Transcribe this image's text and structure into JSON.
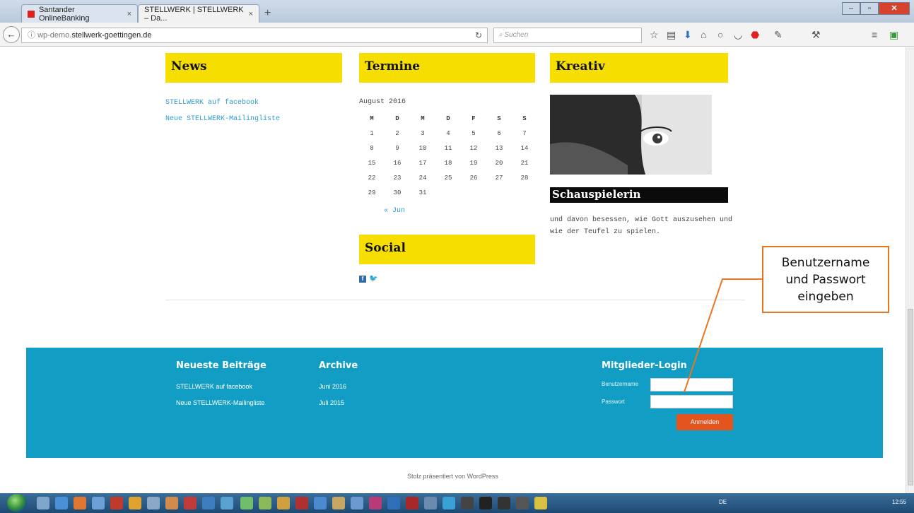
{
  "browser": {
    "tabs": [
      {
        "title": "Santander OnlineBanking",
        "active": false
      },
      {
        "title": "STELLWERK | STELLWERK – Da...",
        "active": true
      }
    ],
    "new_tab_label": "+",
    "close_symbol": "×",
    "url_scheme_part": "wp-demo.",
    "url_host": "stellwerk-goettingen.de",
    "search_placeholder": "Suchen",
    "toolbar_icons": [
      "bookmark-star-icon",
      "reading-list-icon",
      "download-icon",
      "home-icon",
      "hello-icon",
      "pocket-icon",
      "adblock-icon",
      "translate-icon",
      "tools-icon",
      "menu-icon",
      "addon-icon"
    ]
  },
  "widgets": {
    "news": {
      "title": "News",
      "items": [
        "STELLWERK auf facebook",
        "Neue STELLWERK-Mailingliste"
      ]
    },
    "termine": {
      "title": "Termine",
      "caption": "August 2016",
      "weekdays": [
        "M",
        "D",
        "M",
        "D",
        "F",
        "S",
        "S"
      ],
      "weeks": [
        [
          "1",
          "2",
          "3",
          "4",
          "5",
          "6",
          "7"
        ],
        [
          "8",
          "9",
          "10",
          "11",
          "12",
          "13",
          "14"
        ],
        [
          "15",
          "16",
          "17",
          "18",
          "19",
          "20",
          "21"
        ],
        [
          "22",
          "23",
          "24",
          "25",
          "26",
          "27",
          "28"
        ],
        [
          "29",
          "30",
          "31",
          "",
          "",
          "",
          ""
        ]
      ],
      "prev_link": "« Jun"
    },
    "social": {
      "title": "Social",
      "icons": [
        "facebook-icon",
        "twitter-icon"
      ]
    },
    "kreativ": {
      "title": "Kreativ",
      "caption": "Schauspielerin",
      "text": "und davon besessen, wie Gott auszusehen und wie der Teufel zu spielen."
    }
  },
  "footer": {
    "recent_posts": {
      "title": "Neueste Beiträge",
      "items": [
        "STELLWERK auf facebook",
        "Neue STELLWERK-Mailingliste"
      ]
    },
    "archive": {
      "title": "Archive",
      "items": [
        "Juni 2016",
        "Juli 2015"
      ]
    },
    "login": {
      "title": "Mitglieder-Login",
      "username_label": "Benutzername",
      "password_label": "Passwort",
      "submit_label": "Anmelden"
    },
    "credit": "Stolz präsentiert von WordPress"
  },
  "callout": {
    "line1": "Benutzername",
    "line2": "und Passwort",
    "line3": "eingeben"
  },
  "colors": {
    "widget_title_bg": "#f6df00",
    "footer_bg": "#129dc4",
    "login_button": "#e2531d",
    "callout_border": "#e87722",
    "link": "#2d9bcb"
  },
  "taskbar": {
    "language": "DE",
    "clock": "12:55"
  }
}
